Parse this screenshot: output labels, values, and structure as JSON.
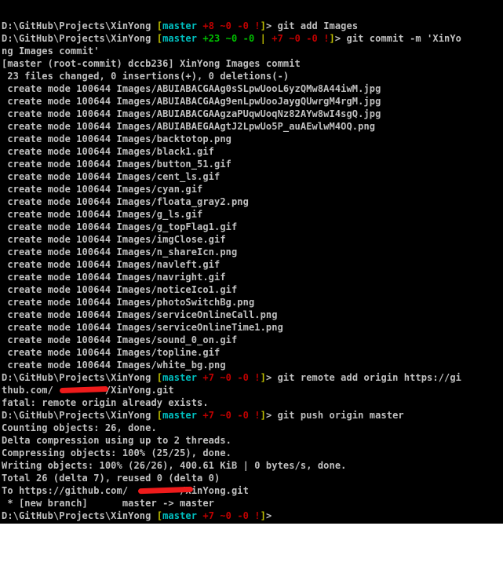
{
  "colors": {
    "default": "#c0c0c0",
    "branch": "#00c0c0",
    "bracket": "#c0c000",
    "ahead_red": "#c00000",
    "staged_green": "#00c000",
    "redaction": "#ee1b1b"
  },
  "lines": [
    {
      "segs": [
        {
          "t": "D:\\GitHub\\Projects\\XinYong ",
          "c": "#c0c0c0"
        },
        {
          "t": "[",
          "c": "#c0c000"
        },
        {
          "t": "master ",
          "c": "#00c0c0"
        },
        {
          "t": "+8 ~0 -0 ",
          "c": "#c00000"
        },
        {
          "t": "!",
          "c": "#c00000"
        },
        {
          "t": "]",
          "c": "#c0c000"
        },
        {
          "t": "> git add Images",
          "c": "#c0c0c0"
        }
      ]
    },
    {
      "segs": [
        {
          "t": "D:\\GitHub\\Projects\\XinYong ",
          "c": "#c0c0c0"
        },
        {
          "t": "[",
          "c": "#c0c000"
        },
        {
          "t": "master ",
          "c": "#00c0c0"
        },
        {
          "t": "+23 ~0 -0 ",
          "c": "#00c000"
        },
        {
          "t": "| ",
          "c": "#c0c000"
        },
        {
          "t": "+7 ~0 -0 !",
          "c": "#c00000"
        },
        {
          "t": "]",
          "c": "#c0c000"
        },
        {
          "t": "> git commit -m 'XinYo",
          "c": "#c0c0c0"
        }
      ]
    },
    {
      "segs": [
        {
          "t": "ng Images commit'",
          "c": "#c0c0c0"
        }
      ]
    },
    {
      "segs": [
        {
          "t": "[master (root-commit) dccb236] XinYong Images commit",
          "c": "#c0c0c0"
        }
      ]
    },
    {
      "segs": [
        {
          "t": " 23 files changed, 0 insertions(+), 0 deletions(-)",
          "c": "#c0c0c0"
        }
      ]
    },
    {
      "segs": [
        {
          "t": " create mode 100644 Images/ABUIABACGAAg0sSLpwUooL6yzQMw8A44iwM.jpg",
          "c": "#c0c0c0"
        }
      ]
    },
    {
      "segs": [
        {
          "t": " create mode 100644 Images/ABUIABACGAAg9enLpwUooJaygQUwrgM4rgM.jpg",
          "c": "#c0c0c0"
        }
      ]
    },
    {
      "segs": [
        {
          "t": " create mode 100644 Images/ABUIABACGAAgzaPUqwUoqNz82AYw8wI4sgQ.jpg",
          "c": "#c0c0c0"
        }
      ]
    },
    {
      "segs": [
        {
          "t": " create mode 100644 Images/ABUIABAEGAAgtJ2LpwUo5P_auAEwlwM4OQ.png",
          "c": "#c0c0c0"
        }
      ]
    },
    {
      "segs": [
        {
          "t": " create mode 100644 Images/backtotop.png",
          "c": "#c0c0c0"
        }
      ]
    },
    {
      "segs": [
        {
          "t": " create mode 100644 Images/black1.gif",
          "c": "#c0c0c0"
        }
      ]
    },
    {
      "segs": [
        {
          "t": " create mode 100644 Images/button_51.gif",
          "c": "#c0c0c0"
        }
      ]
    },
    {
      "segs": [
        {
          "t": " create mode 100644 Images/cent_ls.gif",
          "c": "#c0c0c0"
        }
      ]
    },
    {
      "segs": [
        {
          "t": " create mode 100644 Images/cyan.gif",
          "c": "#c0c0c0"
        }
      ]
    },
    {
      "segs": [
        {
          "t": " create mode 100644 Images/floata_gray2.png",
          "c": "#c0c0c0"
        }
      ]
    },
    {
      "segs": [
        {
          "t": " create mode 100644 Images/g_ls.gif",
          "c": "#c0c0c0"
        }
      ]
    },
    {
      "segs": [
        {
          "t": " create mode 100644 Images/g_topFlag1.gif",
          "c": "#c0c0c0"
        }
      ]
    },
    {
      "segs": [
        {
          "t": " create mode 100644 Images/imgClose.gif",
          "c": "#c0c0c0"
        }
      ]
    },
    {
      "segs": [
        {
          "t": " create mode 100644 Images/n_shareIcn.png",
          "c": "#c0c0c0"
        }
      ]
    },
    {
      "segs": [
        {
          "t": " create mode 100644 Images/navleft.gif",
          "c": "#c0c0c0"
        }
      ]
    },
    {
      "segs": [
        {
          "t": " create mode 100644 Images/navright.gif",
          "c": "#c0c0c0"
        }
      ]
    },
    {
      "segs": [
        {
          "t": " create mode 100644 Images/noticeIco1.gif",
          "c": "#c0c0c0"
        }
      ]
    },
    {
      "segs": [
        {
          "t": " create mode 100644 Images/photoSwitchBg.png",
          "c": "#c0c0c0"
        }
      ]
    },
    {
      "segs": [
        {
          "t": " create mode 100644 Images/serviceOnlineCall.png",
          "c": "#c0c0c0"
        }
      ]
    },
    {
      "segs": [
        {
          "t": " create mode 100644 Images/serviceOnlineTime1.png",
          "c": "#c0c0c0"
        }
      ]
    },
    {
      "segs": [
        {
          "t": " create mode 100644 Images/sound_0_on.gif",
          "c": "#c0c0c0"
        }
      ]
    },
    {
      "segs": [
        {
          "t": " create mode 100644 Images/topline.gif",
          "c": "#c0c0c0"
        }
      ]
    },
    {
      "segs": [
        {
          "t": " create mode 100644 Images/white_bg.png",
          "c": "#c0c0c0"
        }
      ]
    },
    {
      "segs": [
        {
          "t": "D:\\GitHub\\Projects\\XinYong ",
          "c": "#c0c0c0"
        },
        {
          "t": "[",
          "c": "#c0c000"
        },
        {
          "t": "master ",
          "c": "#00c0c0"
        },
        {
          "t": "+7 ~0 -0 !",
          "c": "#c00000"
        },
        {
          "t": "]",
          "c": "#c0c000"
        },
        {
          "t": "> git remote add origin https://gi",
          "c": "#c0c0c0"
        }
      ]
    },
    {
      "segs": [
        {
          "t": "thub.com/         /XinYong.git",
          "c": "#c0c0c0"
        }
      ]
    },
    {
      "segs": [
        {
          "t": "fatal: remote origin already exists.",
          "c": "#c0c0c0"
        }
      ]
    },
    {
      "segs": [
        {
          "t": "D:\\GitHub\\Projects\\XinYong ",
          "c": "#c0c0c0"
        },
        {
          "t": "[",
          "c": "#c0c000"
        },
        {
          "t": "master ",
          "c": "#00c0c0"
        },
        {
          "t": "+7 ~0 -0 !",
          "c": "#c00000"
        },
        {
          "t": "]",
          "c": "#c0c000"
        },
        {
          "t": "> git push origin master",
          "c": "#c0c0c0"
        }
      ]
    },
    {
      "segs": [
        {
          "t": "Counting objects: 26, done.",
          "c": "#c0c0c0"
        }
      ]
    },
    {
      "segs": [
        {
          "t": "Delta compression using up to 2 threads.",
          "c": "#c0c0c0"
        }
      ]
    },
    {
      "segs": [
        {
          "t": "Compressing objects: 100% (25/25), done.",
          "c": "#c0c0c0"
        }
      ]
    },
    {
      "segs": [
        {
          "t": "Writing objects: 100% (26/26), 400.61 KiB | 0 bytes/s, done.",
          "c": "#c0c0c0"
        }
      ]
    },
    {
      "segs": [
        {
          "t": "Total 26 (delta 7), reused 0 (delta 0)",
          "c": "#c0c0c0"
        }
      ]
    },
    {
      "segs": [
        {
          "t": "To https://github.com/         /XinYong.git",
          "c": "#c0c0c0"
        }
      ]
    },
    {
      "segs": [
        {
          "t": " * [new branch]      master -> master",
          "c": "#c0c0c0"
        }
      ]
    },
    {
      "segs": [
        {
          "t": "D:\\GitHub\\Projects\\XinYong ",
          "c": "#c0c0c0"
        },
        {
          "t": "[",
          "c": "#c0c000"
        },
        {
          "t": "master ",
          "c": "#00c0c0"
        },
        {
          "t": "+7 ~0 -0 !",
          "c": "#c00000"
        },
        {
          "t": "]",
          "c": "#c0c000"
        },
        {
          "t": ">",
          "c": "#c0c0c0"
        }
      ]
    }
  ]
}
